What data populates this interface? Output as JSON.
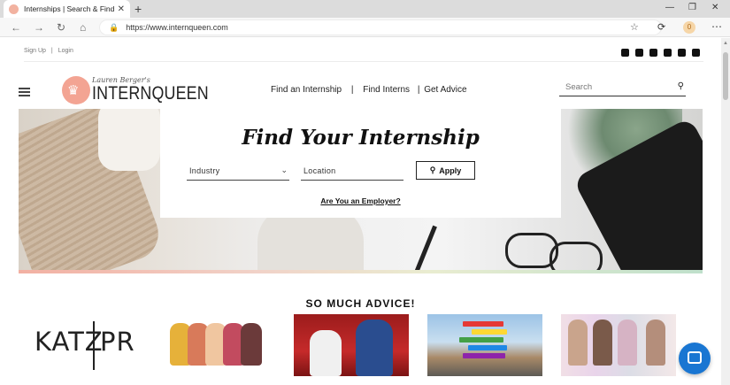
{
  "browser": {
    "tab_title": "Internships | Search & Find Your",
    "tab_close": "✕",
    "new_tab": "+",
    "url": "https://www.internqueen.com",
    "window_controls": [
      "—",
      "❐",
      "✕"
    ],
    "extension_badge": "0"
  },
  "topbar": {
    "sign_up": "Sign Up",
    "separator": "|",
    "login": "Login",
    "social_icons": [
      "twitter-icon",
      "facebook-icon",
      "youtube-icon",
      "pinterest-icon",
      "instagram-icon",
      "linkedin-icon"
    ]
  },
  "logo": {
    "script": "Lauren Berger's",
    "wordmark": "INTERNQUEEN",
    "crown": "♛"
  },
  "nav": {
    "find_internship": "Find an Internship",
    "sep1": "|",
    "find_interns": "Find Interns",
    "sep2": "|",
    "get_advice": "Get Advice"
  },
  "search": {
    "placeholder": "Search"
  },
  "hero": {
    "title": "Find Your Internship",
    "industry_label": "Industry",
    "location_label": "Location",
    "apply_label": "Apply",
    "employer_link": "Are You an Employer?"
  },
  "advice": {
    "title": "SO MUCH ADVICE!",
    "katz_pr": "KATZ",
    "katz_pr_right": "PR"
  },
  "colors": {
    "accent": "#f3a493",
    "chat": "#1976d2"
  }
}
